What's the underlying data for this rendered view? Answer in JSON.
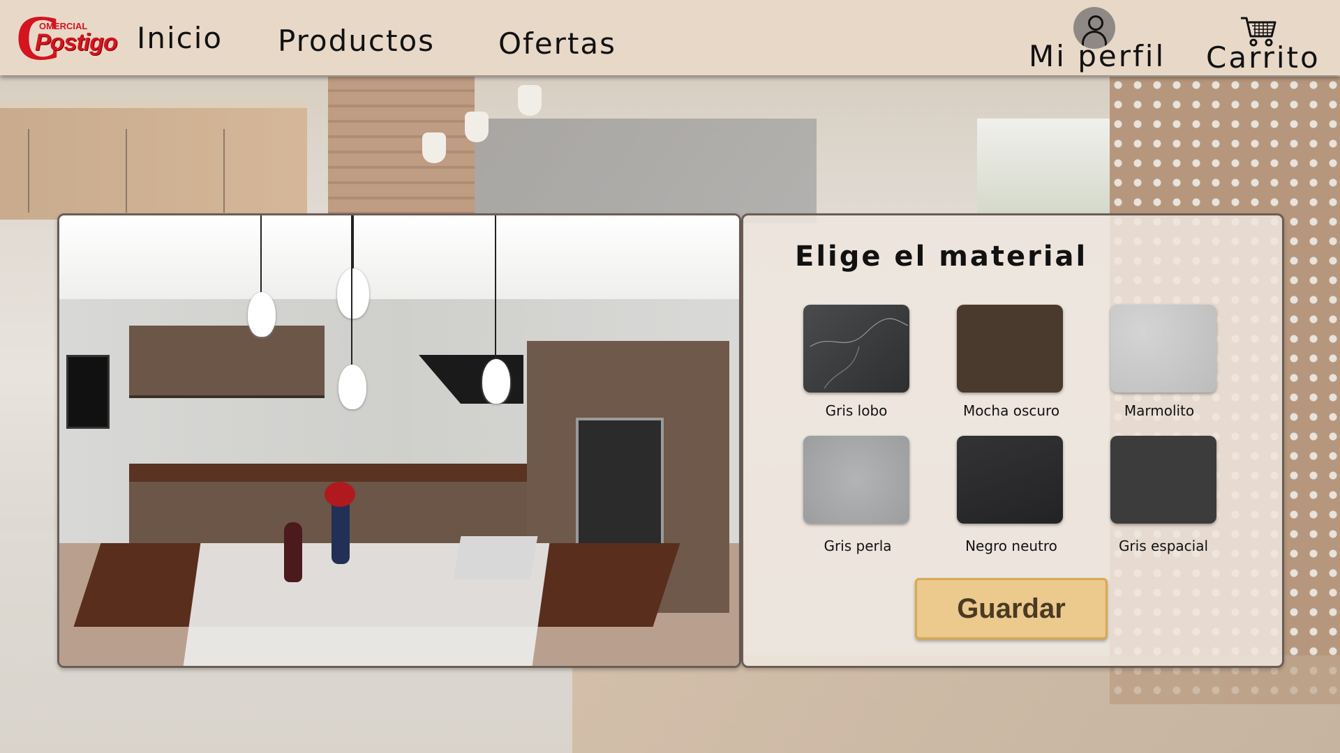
{
  "brand": {
    "logo_small": "OMERCIAL",
    "logo_big": "Postigo",
    "logo_letter": "C"
  },
  "nav": {
    "inicio": "Inicio",
    "productos": "Productos",
    "ofertas": "Ofertas",
    "profile": "Mi perfil",
    "cart": "Carrito"
  },
  "panel": {
    "title": "Elige el material",
    "save_label": "Guardar",
    "materials": [
      {
        "label": "Gris lobo",
        "color": "#3a3b3c"
      },
      {
        "label": "Mocha oscuro",
        "color": "#4a3a2e"
      },
      {
        "label": "Marmolito",
        "color": "#c9c9c9"
      },
      {
        "label": "Gris perla",
        "color": "#a8a9aa"
      },
      {
        "label": "Negro neutro",
        "color": "#2b2b2d"
      },
      {
        "label": "Gris espacial",
        "color": "#3c3c3d"
      }
    ]
  },
  "colors": {
    "navbar": "#e8d8c8",
    "accent_red": "#d4141e",
    "button": "#ecc98c"
  },
  "icons": {
    "profile": "user-circle-icon",
    "cart": "shopping-cart-icon"
  }
}
